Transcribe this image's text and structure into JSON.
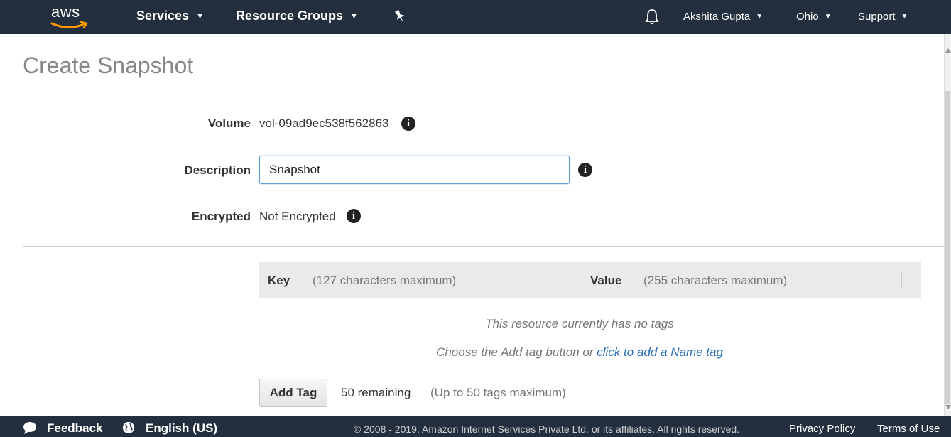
{
  "nav": {
    "logo_text": "aws",
    "services": "Services",
    "resource_groups": "Resource Groups",
    "user": "Akshita Gupta",
    "region": "Ohio",
    "support": "Support",
    "icons": [
      "pin-icon",
      "bell-icon",
      "caret-down-icon"
    ]
  },
  "page": {
    "title": "Create Snapshot"
  },
  "form": {
    "volume_label": "Volume",
    "volume_value": "vol-09ad9ec538f562863",
    "description_label": "Description",
    "description_value": "Snapshot",
    "encrypted_label": "Encrypted",
    "encrypted_value": "Not Encrypted"
  },
  "tags": {
    "key_header": "Key",
    "key_hint": "(127 characters maximum)",
    "value_header": "Value",
    "value_hint": "(255 characters maximum)",
    "empty_message": "This resource currently has no tags",
    "choose_prefix": "Choose the Add tag button or ",
    "choose_link": "click to add a Name tag",
    "add_button": "Add Tag",
    "remaining": "50 remaining",
    "max_hint": "(Up to 50 tags maximum)"
  },
  "footer": {
    "feedback": "Feedback",
    "language": "English (US)",
    "copyright": "© 2008 - 2019, Amazon Internet Services Private Ltd. or its affiliates. All rights reserved.",
    "privacy": "Privacy Policy",
    "terms": "Terms of Use"
  },
  "colors": {
    "nav_bg": "#232f3e",
    "link": "#2a6ebb",
    "logo_smile": "#ff9900"
  }
}
